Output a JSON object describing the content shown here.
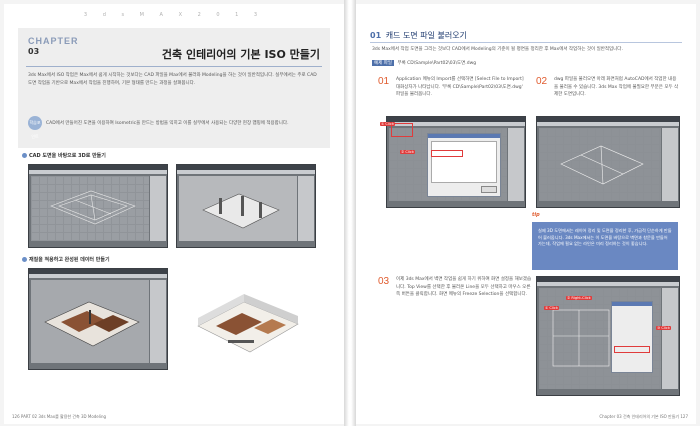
{
  "left_page": {
    "running_head": "3 d s   M A X   2 0 1 3",
    "chapter_label": "CHAPTER",
    "chapter_number": "03",
    "chapter_title": "건축 인테리어의 기본 ISO 만들기",
    "intro_text": "3ds Max에서 ISO 작업은 Max에서 쉽게 시작하는 것보다는 CAD 파일을 Max에서 불러와 Modeling을 하는 것이 일반적입니다. 실무에서는 주로 CAD 도면 작업을 기반으로 Max에서 작업을 진행하며, 기본 형태를 만드는 과정을 살펴봅니다.",
    "tip_badge": "학습포인트",
    "tip_text": "CAD에서 만들어진 도면을 이용하여 Isometric을 만드는 방법을 익히고 이를 실무에서 사용되는 다양한 현장 맵핑에 적용합니다.",
    "section1": "CAD 도면을 바탕으로 3D로 만들기",
    "section2": "재질을 적용하고 완성된 데이터 만들기",
    "footer": "126  PART 02 3ds Max를 활용한 건축 3D Modeling"
  },
  "right_page": {
    "section_number": "01",
    "section_title": "캐드 도면 파일 불러오기",
    "section_desc": "3ds Max에서 작업 도면을 그리는 것보다 CAD에서 Modeling의 기준이 될 평면을 정리한 후 Max에서 작업하는 것이 일반적입니다.",
    "example_label": "예제 파일",
    "example_path": "부록 CD\\Sample\\Part02\\03\\도면.dwg",
    "step1_num": "01",
    "step1_text": "Application 메뉴의 Import를 선택하면 [Select File to Import] 대화상자가 나타납니다. '부록 CD\\Sample\\Part02\\03\\도면.dwg' 파일을 불러옵니다.",
    "step2_num": "02",
    "step2_text": "dwg 파일을 불러오면 아래 화면처럼 AutoCAD에서 작업한 내용을 불러올 수 있습니다. 3ds Max 작업에 불필요한 부분은 모두 삭제한 도면입니다.",
    "step3_num": "03",
    "step3_text": "이제 3ds Max에서 벽면 작업을 쉽게 하기 위하여 화면 설정을 해보겠습니다. Top View를 선택한 후 불러온 Line을 모두 선택하고 마우스 오른쪽 버튼을 클릭합니다. 화면 메뉴의 Freeze Selection을 선택합니다.",
    "tip_label": "tip",
    "tip_text": "실제 3D 도면에서는 레이어 정리 및 도면을 정리한 후, 가급적 단순하게 만들어 불러옵니다. 3ds Max에서는 이 도면을 바탕으로 벽면과 창문을 만들어 가는데, 작업에 필요 없는 라인은 미리 정리하는 것이 좋습니다.",
    "callout_1": "① Click",
    "callout_2": "② Click",
    "callout_3": "① Click",
    "callout_4": "② Right-Click",
    "callout_5": "③ Click",
    "footer": "Chapter 03 건축 인테리어의 기본 ISO 만들기  127"
  }
}
